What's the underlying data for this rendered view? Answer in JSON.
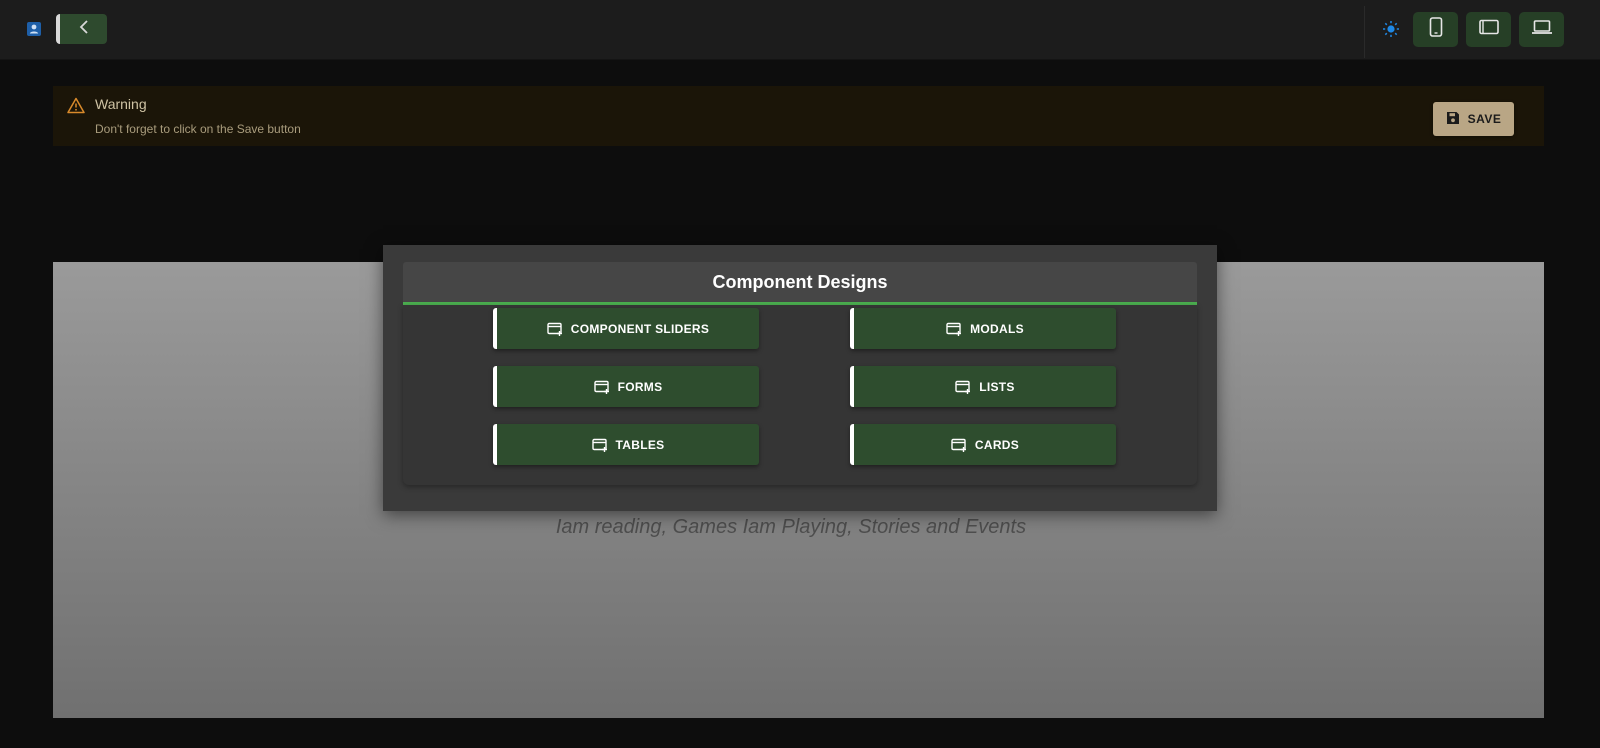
{
  "topbar": {
    "profile_icon": "profile-card-icon",
    "back_icon": "chevron-left-icon",
    "theme_icon": "sun-icon",
    "device_buttons": [
      {
        "name": "mobile-view",
        "icon": "smartphone-icon"
      },
      {
        "name": "tablet-view",
        "icon": "tablet-icon"
      },
      {
        "name": "desktop-view",
        "icon": "laptop-icon"
      }
    ],
    "accent_color": "#2e4a2e",
    "theme_icon_color": "#1e88e5"
  },
  "warning": {
    "title": "Warning",
    "message": "Don't forget to click on the Save button",
    "icon": "warning-triangle-icon",
    "save_label": "SAVE",
    "save_icon": "floppy-disk-icon"
  },
  "preview": {
    "subtitle": "Iam reading, Games Iam Playing, Stories and Events"
  },
  "modal": {
    "title": "Component Designs",
    "accent_color": "#4caf50",
    "buttons": [
      {
        "label": "COMPONENT SLIDERS",
        "icon": "card-add-icon"
      },
      {
        "label": "MODALS",
        "icon": "card-add-icon"
      },
      {
        "label": "FORMS",
        "icon": "card-add-icon"
      },
      {
        "label": "LISTS",
        "icon": "card-add-icon"
      },
      {
        "label": "TABLES",
        "icon": "card-add-icon"
      },
      {
        "label": "CARDS",
        "icon": "card-add-icon"
      }
    ]
  }
}
